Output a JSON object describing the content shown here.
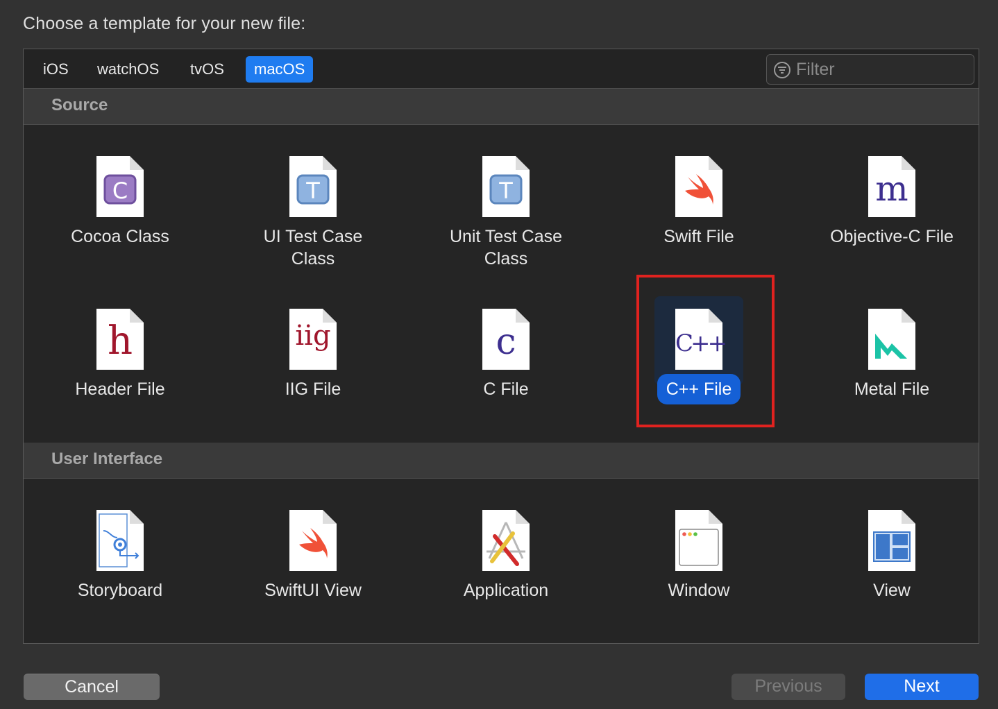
{
  "dialog": {
    "prompt": "Choose a template for your new file:"
  },
  "platform_tabs": [
    {
      "label": "iOS",
      "selected": false
    },
    {
      "label": "watchOS",
      "selected": false
    },
    {
      "label": "tvOS",
      "selected": false
    },
    {
      "label": "macOS",
      "selected": true
    }
  ],
  "filter": {
    "placeholder": "Filter",
    "value": ""
  },
  "sections": {
    "source": {
      "title": "Source",
      "items": [
        {
          "label": "Cocoa Class",
          "icon": "cocoa-class-icon"
        },
        {
          "label": "UI Test Case Class",
          "icon": "test-case-icon"
        },
        {
          "label": "Unit Test Case Class",
          "icon": "test-case-icon"
        },
        {
          "label": "Swift File",
          "icon": "swift-icon"
        },
        {
          "label": "Objective-C File",
          "icon": "objc-icon",
          "glyph": "m"
        },
        {
          "label": "Header File",
          "icon": "header-icon",
          "glyph": "h"
        },
        {
          "label": "IIG File",
          "icon": "iig-icon",
          "glyph": "iig"
        },
        {
          "label": "C File",
          "icon": "c-file-icon",
          "glyph": "c"
        },
        {
          "label": "C++ File",
          "icon": "cpp-file-icon",
          "glyph": "C++",
          "selected": true
        },
        {
          "label": "Metal File",
          "icon": "metal-icon"
        }
      ]
    },
    "user_interface": {
      "title": "User Interface",
      "items": [
        {
          "label": "Storyboard",
          "icon": "storyboard-icon"
        },
        {
          "label": "SwiftUI View",
          "icon": "swift-icon"
        },
        {
          "label": "Application",
          "icon": "application-icon"
        },
        {
          "label": "Window",
          "icon": "window-icon"
        },
        {
          "label": "View",
          "icon": "view-icon"
        }
      ]
    }
  },
  "buttons": {
    "cancel": "Cancel",
    "previous": "Previous",
    "next": "Next"
  },
  "colors": {
    "accent": "#1f7cf0",
    "highlight_box": "#e0221f",
    "background": "#323232",
    "panel": "#252525"
  }
}
